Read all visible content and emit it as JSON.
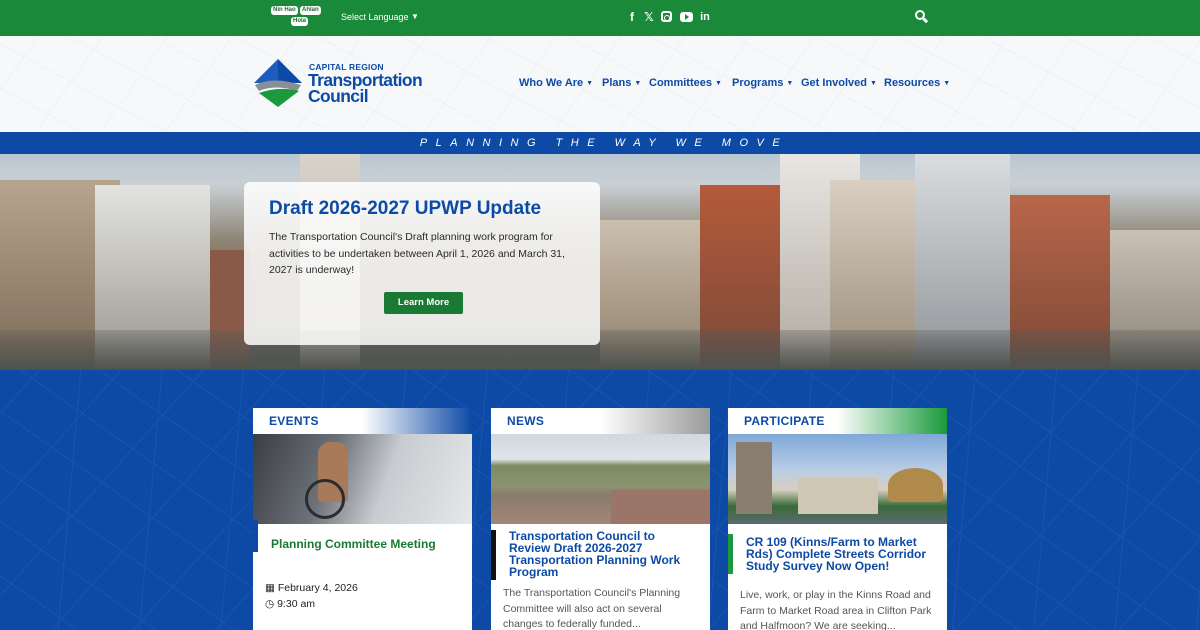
{
  "topbar": {
    "lang_badges": [
      "Nin Hao",
      "Ahlan",
      "Hola"
    ],
    "lang_select": "Select Language",
    "lang_caret": "▼",
    "social": {
      "facebook": "f",
      "x": "𝕏",
      "linkedin": "in"
    }
  },
  "header": {
    "logo_small": "CAPITAL REGION",
    "logo_line1": "Transportation",
    "logo_line2": "Council",
    "nav": [
      "Who We Are",
      "Plans",
      "Committees",
      "Programs",
      "Get Involved",
      "Resources"
    ],
    "nav_caret": "▼"
  },
  "tagline": "PLANNING THE WAY WE MOVE",
  "hero": {
    "title": "Draft 2026-2027 UPWP Update",
    "body": "The Transportation Council's Draft planning work program for activities to be undertaken between April 1, 2026 and March 31, 2027 is underway!",
    "button": "Learn More"
  },
  "cards": {
    "events": {
      "label": "EVENTS",
      "title": "Planning Committee Meeting",
      "date": "February 4, 2026",
      "time": "9:30 am"
    },
    "news": {
      "label": "NEWS",
      "title": "Transportation Council to Review Draft 2026-2027 Transportation Planning Work Program",
      "excerpt": "The Transportation Council's Planning Committee will also act on several changes to federally funded..."
    },
    "participate": {
      "label": "PARTICIPATE",
      "title": "CR 109 (Kinns/Farm to Market Rds) Complete Streets Corridor Study Survey Now Open!",
      "excerpt": "Live, work, or play in the Kinns Road and Farm to Market Road area in Clifton Park and Halfmoon? We are seeking..."
    }
  },
  "colors": {
    "green": "#1a8a3a",
    "blue": "#0d4aa5",
    "button_green": "#1a7a33"
  }
}
